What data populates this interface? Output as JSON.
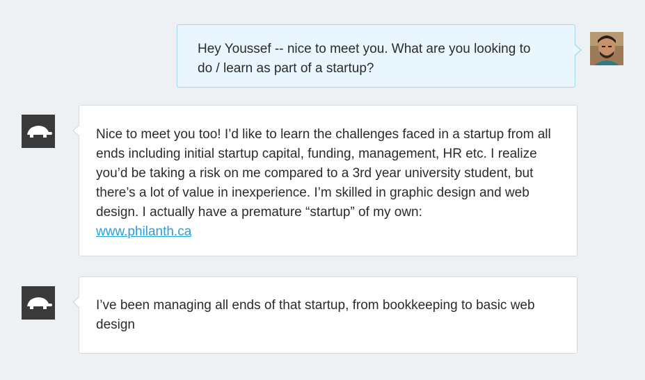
{
  "colors": {
    "background": "#eef1f4",
    "outgoing_bubble": "#eaf6fd",
    "outgoing_border": "#a9d6ef",
    "incoming_bubble": "#ffffff",
    "incoming_border": "#d6dbe0",
    "link": "#2a9fd6",
    "bot_avatar": "#3a3a3a"
  },
  "messages": [
    {
      "direction": "outgoing",
      "avatar_icon": "user-photo-avatar",
      "text": "Hey Youssef -- nice to meet you. What are you looking to do / learn as part of a startup?"
    },
    {
      "direction": "incoming",
      "avatar_icon": "turtle-icon",
      "text": "Nice to meet you too! I’d like to learn the challenges faced in a startup from all ends including initial startup capital, funding, management, HR etc. I realize you’d be taking a risk on me compared to a 3rd year university student, but there’s a lot of value in inexperience. I’m skilled in graphic design and web design. I actually have a premature “startup” of my own:",
      "link_text": "www.philanth.ca"
    },
    {
      "direction": "incoming",
      "avatar_icon": "turtle-icon",
      "text": "I’ve been managing all ends of that startup, from bookkeeping to basic web design"
    }
  ]
}
